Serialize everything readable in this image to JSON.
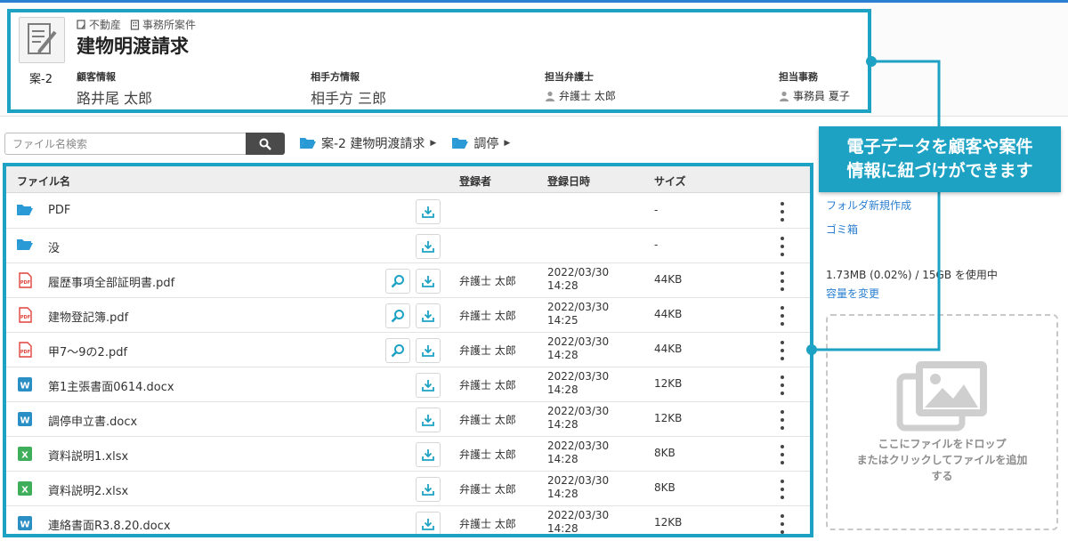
{
  "case": {
    "tags": [
      "不動産",
      "事務所案件"
    ],
    "title": "建物明渡請求",
    "number": "案-2",
    "client_label": "顧客情報",
    "client_value": "路井尾 太郎",
    "opponent_label": "相手方情報",
    "opponent_value": "相手方 三郎",
    "lawyer_label": "担当弁護士",
    "lawyer_value": "弁護士 太郎",
    "staff_label": "担当事務",
    "staff_value": "事務員 夏子"
  },
  "search": {
    "placeholder": "ファイル名検索"
  },
  "breadcrumb": [
    "案-2 建物明渡請求",
    "調停"
  ],
  "table": {
    "headers": {
      "name": "ファイル名",
      "registrant": "登録者",
      "date": "登録日時",
      "size": "サイズ"
    },
    "rows": [
      {
        "type": "folder",
        "name": "PDF",
        "registrant": "",
        "date": "",
        "time": "",
        "size": "-",
        "preview": false
      },
      {
        "type": "folder",
        "name": "没",
        "registrant": "",
        "date": "",
        "time": "",
        "size": "-",
        "preview": false
      },
      {
        "type": "pdf",
        "name": "履歴事項全部証明書.pdf",
        "registrant": "弁護士 太郎",
        "date": "2022/03/30",
        "time": "14:28",
        "size": "44KB",
        "preview": true
      },
      {
        "type": "pdf",
        "name": "建物登記簿.pdf",
        "registrant": "弁護士 太郎",
        "date": "2022/03/30",
        "time": "14:25",
        "size": "44KB",
        "preview": true
      },
      {
        "type": "pdf",
        "name": "甲7～9の2.pdf",
        "registrant": "弁護士 太郎",
        "date": "2022/03/30",
        "time": "14:28",
        "size": "44KB",
        "preview": true
      },
      {
        "type": "word",
        "name": "第1主張書面0614.docx",
        "registrant": "弁護士 太郎",
        "date": "2022/03/30",
        "time": "14:28",
        "size": "12KB",
        "preview": false
      },
      {
        "type": "word",
        "name": "調停申立書.docx",
        "registrant": "弁護士 太郎",
        "date": "2022/03/30",
        "time": "14:28",
        "size": "12KB",
        "preview": false
      },
      {
        "type": "excel",
        "name": "資料説明1.xlsx",
        "registrant": "弁護士 太郎",
        "date": "2022/03/30",
        "time": "14:28",
        "size": "8KB",
        "preview": false
      },
      {
        "type": "excel",
        "name": "資料説明2.xlsx",
        "registrant": "弁護士 太郎",
        "date": "2022/03/30",
        "time": "14:28",
        "size": "8KB",
        "preview": false
      },
      {
        "type": "word",
        "name": "連絡書面R3.8.20.docx",
        "registrant": "弁護士 太郎",
        "date": "2022/03/30",
        "time": "14:28",
        "size": "12KB",
        "preview": false
      }
    ]
  },
  "sidebar": {
    "new_folder": "フォルダ新規作成",
    "trash": "ゴミ箱",
    "usage": "1.73MB (0.02%) / 15GB を使用中",
    "change_capacity": "容量を変更"
  },
  "dropzone": {
    "line1": "ここにファイルをドロップ",
    "line2": "またはクリックしてファイルを追加",
    "line3": "する"
  },
  "callout": {
    "line1": "電子データを顧客や案件",
    "line2": "情報に紐づけができます"
  },
  "icon_glyphs": {
    "pdf": "PDF",
    "word": "W",
    "excel": "X"
  },
  "colors": {
    "accent": "#1da2c4",
    "link": "#2a7fd0",
    "folder": "#2a9ad6",
    "pdf": "#e0433a",
    "word": "#2a8fc4",
    "excel": "#3fae5a"
  }
}
